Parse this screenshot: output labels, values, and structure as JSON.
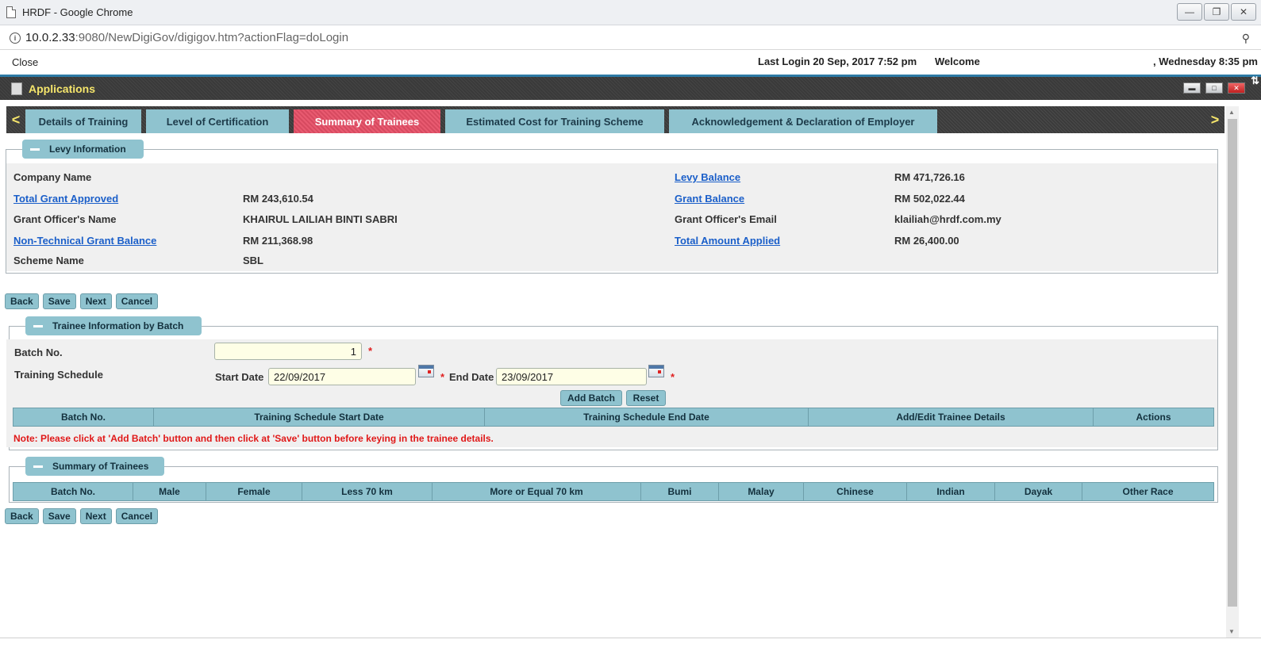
{
  "browser": {
    "window_title": "HRDF - Google Chrome",
    "url_host": "10.0.2.33",
    "url_rest": ":9080/NewDigiGov/digigov.htm?actionFlag=doLogin",
    "win_min": "—",
    "win_max": "❐",
    "win_close": "✕"
  },
  "topline": {
    "close_label": "Close",
    "last_login": "Last Login 20 Sep, 2017 7:52 pm",
    "welcome": "Welcome",
    "datetime": ", Wednesday 8:35 pm"
  },
  "appbar": {
    "title": "Applications",
    "updown": "⇅"
  },
  "tabs": {
    "prev": "<",
    "next": ">",
    "items": [
      {
        "label": "Details of Training"
      },
      {
        "label": "Level of Certification"
      },
      {
        "label": "Summary of Trainees",
        "active": true
      },
      {
        "label": "Estimated Cost for Training Scheme"
      },
      {
        "label": "Acknowledgement & Declaration of Employer"
      }
    ]
  },
  "levy": {
    "legend": "Levy Information",
    "company_name_label": "Company Name",
    "company_name_value": "",
    "total_grant_label": "Total Grant Approved",
    "total_grant_value": "RM 243,610.54",
    "officer_name_label": "Grant Officer's Name",
    "officer_name_value": "KHAIRUL LAILIAH BINTI SABRI",
    "nontech_label": "Non-Technical Grant Balance",
    "nontech_value": "RM 211,368.98",
    "scheme_label": "Scheme Name",
    "scheme_value": "SBL",
    "levy_balance_label": "Levy Balance",
    "levy_balance_value": "RM 471,726.16",
    "grant_balance_label": "Grant Balance",
    "grant_balance_value": "RM 502,022.44",
    "officer_email_label": "Grant Officer's Email",
    "officer_email_value": "klailiah@hrdf.com.my",
    "total_applied_label": "Total Amount Applied",
    "total_applied_value": "RM 26,400.00"
  },
  "actions": {
    "back": "Back",
    "save": "Save",
    "next": "Next",
    "cancel": "Cancel"
  },
  "batch": {
    "legend": "Trainee Information by Batch",
    "batch_no_label": "Batch No.",
    "batch_no_value": "1",
    "training_schedule_label": "Training Schedule",
    "start_date_label": "Start Date",
    "start_date_value": "22/09/2017",
    "end_date_label": "End Date",
    "end_date_value": "23/09/2017",
    "required_mark": "*",
    "add_batch": "Add Batch",
    "reset": "Reset",
    "columns": [
      "Batch No.",
      "Training Schedule Start Date",
      "Training Schedule End Date",
      "Add/Edit Trainee Details",
      "Actions"
    ],
    "note": "Note: Please click at 'Add Batch' button and then click at 'Save' button before keying in the trainee details."
  },
  "summary": {
    "legend": "Summary of Trainees",
    "columns": [
      "Batch No.",
      "Male",
      "Female",
      "Less 70 km",
      "More or Equal 70 km",
      "Bumi",
      "Malay",
      "Chinese",
      "Indian",
      "Dayak",
      "Other Race"
    ]
  }
}
